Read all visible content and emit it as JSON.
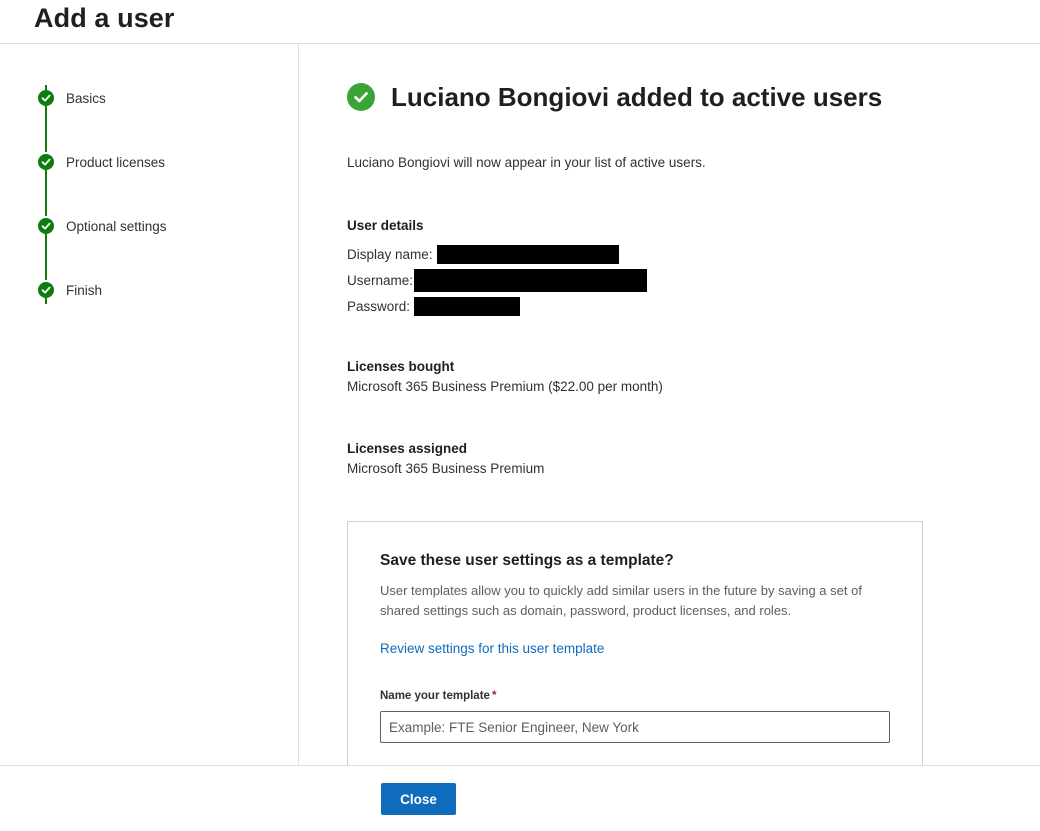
{
  "header": {
    "title": "Add a user"
  },
  "steps": [
    {
      "label": "Basics",
      "status": "complete"
    },
    {
      "label": "Product licenses",
      "status": "complete"
    },
    {
      "label": "Optional settings",
      "status": "complete"
    },
    {
      "label": "Finish",
      "status": "complete"
    }
  ],
  "main": {
    "title": "Luciano Bongiovi added to active users",
    "description": "Luciano Bongiovi will now appear in your list of active users.",
    "user_details": {
      "heading": "User details",
      "display_name_label": "Display name:",
      "username_label": "Username:",
      "password_label": "Password:"
    },
    "licenses_bought": {
      "heading": "Licenses bought",
      "value": "Microsoft 365 Business Premium ($22.00 per month)"
    },
    "licenses_assigned": {
      "heading": "Licenses assigned",
      "value": "Microsoft 365 Business Premium"
    },
    "template": {
      "title": "Save these user settings as a template?",
      "description": "User templates allow you to quickly add similar users in the future by saving a set of shared settings such as domain, password, product licenses, and roles.",
      "link": "Review settings for this user template",
      "name_label": "Name your template",
      "required_marker": "*",
      "placeholder": "Example: FTE Senior Engineer, New York"
    }
  },
  "footer": {
    "close_label": "Close"
  },
  "colors": {
    "step_complete": "#107c10",
    "success": "#3aa536",
    "primary": "#0f6cbd",
    "link": "#0f6cbd",
    "required": "#a4262c"
  }
}
